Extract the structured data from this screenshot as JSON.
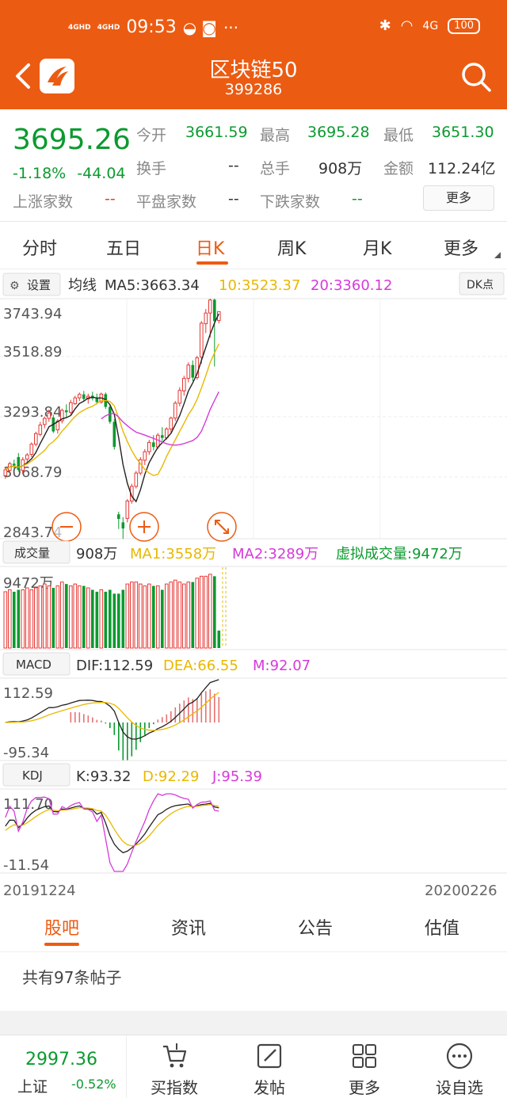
{
  "status": {
    "net1": "4GHD",
    "net2": "4GHD",
    "time": "09:53",
    "extra": "···",
    "network_type": "4G",
    "battery": "100"
  },
  "header": {
    "title": "区块链50",
    "code": "399286"
  },
  "quote": {
    "price": "3695.26",
    "pct": "-1.18%",
    "change": "-44.04",
    "open_label": "今开",
    "open": "3661.59",
    "high_label": "最高",
    "high": "3695.28",
    "low_label": "最低",
    "low": "3651.30",
    "turnover_label": "换手",
    "turnover": "--",
    "volume_label": "总手",
    "volume": "908万",
    "amount_label": "金额",
    "amount": "112.24亿",
    "up_label": "上涨家数",
    "up": "--",
    "flat_label": "平盘家数",
    "flat": "--",
    "down_label": "下跌家数",
    "down": "--",
    "more": "更多"
  },
  "tabs": [
    {
      "label": "分时"
    },
    {
      "label": "五日"
    },
    {
      "label": "日K"
    },
    {
      "label": "周K"
    },
    {
      "label": "月K"
    },
    {
      "label": "更多"
    }
  ],
  "chart_toolbar": {
    "settings": "设置",
    "ma_title": "均线",
    "ma5": "MA5:3663.34",
    "ma10": "10:3523.37",
    "ma20": "20:3360.12",
    "dk": "DK点"
  },
  "volume_bar": {
    "label": "成交量",
    "vol": "908万",
    "ma1": "MA1:3558万",
    "ma2": "MA2:3289万",
    "virtual": "虚拟成交量:9472万"
  },
  "macd_bar": {
    "label": "MACD",
    "dif": "DIF:112.59",
    "dea": "DEA:66.55",
    "m": "M:92.07"
  },
  "kdj_bar": {
    "label": "KDJ",
    "k": "K:93.32",
    "d": "D:92.29",
    "j": "J:95.39"
  },
  "chart_data": {
    "type": "candlestick",
    "x_range": [
      "20191224",
      "20200226"
    ],
    "price_axis": {
      "ticks": [
        "3743.94",
        "3518.89",
        "3293.84",
        "3068.79",
        "2843.74"
      ],
      "ylim": [
        2843.74,
        3743.94
      ]
    },
    "volume_axis": {
      "ticks": [
        "9472万"
      ]
    },
    "macd_axis": {
      "ticks": [
        "112.59",
        "-95.34"
      ]
    },
    "kdj_axis": {
      "ticks": [
        "111.70",
        "-11.54"
      ]
    },
    "candles": [
      {
        "o": 3080,
        "h": 3110,
        "l": 3068,
        "c": 3102
      },
      {
        "o": 3100,
        "h": 3132,
        "l": 3085,
        "c": 3125
      },
      {
        "o": 3125,
        "h": 3140,
        "l": 3108,
        "c": 3118
      },
      {
        "o": 3150,
        "h": 3165,
        "l": 3095,
        "c": 3102
      },
      {
        "o": 3100,
        "h": 3150,
        "l": 3088,
        "c": 3140
      },
      {
        "o": 3142,
        "h": 3165,
        "l": 3125,
        "c": 3158
      },
      {
        "o": 3160,
        "h": 3205,
        "l": 3150,
        "c": 3198
      },
      {
        "o": 3198,
        "h": 3245,
        "l": 3190,
        "c": 3238
      },
      {
        "o": 3235,
        "h": 3282,
        "l": 3228,
        "c": 3270
      },
      {
        "o": 3272,
        "h": 3302,
        "l": 3258,
        "c": 3295
      },
      {
        "o": 3295,
        "h": 3328,
        "l": 3282,
        "c": 3315
      },
      {
        "o": 3298,
        "h": 3308,
        "l": 3240,
        "c": 3246
      },
      {
        "o": 3252,
        "h": 3292,
        "l": 3238,
        "c": 3285
      },
      {
        "o": 3286,
        "h": 3332,
        "l": 3276,
        "c": 3325
      },
      {
        "o": 3325,
        "h": 3348,
        "l": 3300,
        "c": 3318
      },
      {
        "o": 3318,
        "h": 3365,
        "l": 3310,
        "c": 3354
      },
      {
        "o": 3350,
        "h": 3380,
        "l": 3345,
        "c": 3372
      },
      {
        "o": 3372,
        "h": 3392,
        "l": 3360,
        "c": 3385
      },
      {
        "o": 3385,
        "h": 3398,
        "l": 3360,
        "c": 3368
      },
      {
        "o": 3368,
        "h": 3388,
        "l": 3350,
        "c": 3378
      },
      {
        "o": 3380,
        "h": 3395,
        "l": 3362,
        "c": 3370
      },
      {
        "o": 3370,
        "h": 3388,
        "l": 3348,
        "c": 3356
      },
      {
        "o": 3356,
        "h": 3392,
        "l": 3350,
        "c": 3386
      },
      {
        "o": 3386,
        "h": 3392,
        "l": 3330,
        "c": 3338
      },
      {
        "o": 3338,
        "h": 3345,
        "l": 3275,
        "c": 3282
      },
      {
        "o": 3282,
        "h": 3292,
        "l": 3178,
        "c": 3188
      },
      {
        "o": 2935,
        "h": 2945,
        "l": 2880,
        "c": 2918
      },
      {
        "o": 2905,
        "h": 2925,
        "l": 2843,
        "c": 2882
      },
      {
        "o": 2920,
        "h": 2992,
        "l": 2905,
        "c": 2985
      },
      {
        "o": 2985,
        "h": 3050,
        "l": 2975,
        "c": 3040
      },
      {
        "o": 3040,
        "h": 3098,
        "l": 3032,
        "c": 3090
      },
      {
        "o": 3090,
        "h": 3150,
        "l": 3082,
        "c": 3140
      },
      {
        "o": 3138,
        "h": 3180,
        "l": 3120,
        "c": 3170
      },
      {
        "o": 3170,
        "h": 3215,
        "l": 3158,
        "c": 3205
      },
      {
        "o": 3205,
        "h": 3232,
        "l": 3175,
        "c": 3188
      },
      {
        "o": 3188,
        "h": 3240,
        "l": 3180,
        "c": 3232
      },
      {
        "o": 3232,
        "h": 3262,
        "l": 3210,
        "c": 3222
      },
      {
        "o": 3222,
        "h": 3262,
        "l": 3215,
        "c": 3255
      },
      {
        "o": 3255,
        "h": 3302,
        "l": 3242,
        "c": 3296
      },
      {
        "o": 3296,
        "h": 3360,
        "l": 3285,
        "c": 3352
      },
      {
        "o": 3352,
        "h": 3412,
        "l": 3340,
        "c": 3400
      },
      {
        "o": 3398,
        "h": 3455,
        "l": 3380,
        "c": 3445
      },
      {
        "o": 3445,
        "h": 3505,
        "l": 3430,
        "c": 3495
      },
      {
        "o": 3495,
        "h": 3512,
        "l": 3435,
        "c": 3448
      },
      {
        "o": 3448,
        "h": 3530,
        "l": 3440,
        "c": 3522
      },
      {
        "o": 3525,
        "h": 3660,
        "l": 3500,
        "c": 3652
      },
      {
        "o": 3650,
        "h": 3705,
        "l": 3615,
        "c": 3690
      },
      {
        "o": 3690,
        "h": 3744,
        "l": 3598,
        "c": 3739
      },
      {
        "o": 3740,
        "h": 3744,
        "l": 3490,
        "c": 3660
      },
      {
        "o": 3662,
        "h": 3695,
        "l": 3651,
        "c": 3695
      }
    ],
    "volume_up": [
      true,
      true,
      false,
      false,
      true,
      true,
      true,
      true,
      true,
      true,
      true,
      false,
      true,
      true,
      false,
      true,
      true,
      true,
      false,
      true,
      false,
      false,
      true,
      false,
      false,
      false,
      false,
      false,
      true,
      true,
      true,
      true,
      true,
      true,
      false,
      true,
      false,
      true,
      true,
      true,
      true,
      true,
      true,
      false,
      true,
      true,
      true,
      true,
      false,
      false
    ],
    "volume": [
      29,
      30,
      29,
      30,
      30,
      31,
      30,
      31,
      32,
      33,
      32,
      31,
      32,
      34,
      33,
      32,
      33,
      32,
      32,
      31,
      30,
      29,
      30,
      29,
      30,
      28,
      28,
      30,
      33,
      34,
      34,
      33,
      32,
      33,
      32,
      32,
      30,
      33,
      34,
      35,
      34,
      33,
      34,
      34,
      36,
      37,
      37,
      38,
      37,
      9
    ]
  },
  "bottom_tabs": [
    {
      "label": "股吧"
    },
    {
      "label": "资讯"
    },
    {
      "label": "公告"
    },
    {
      "label": "估值"
    }
  ],
  "posts": {
    "count_text": "共有97条帖子"
  },
  "bottom_bar": {
    "index_value": "2997.36",
    "index_name": "上证",
    "index_change": "-0.52%",
    "buy_index": "买指数",
    "post": "发帖",
    "more": "更多",
    "watchlist": "设自选"
  }
}
